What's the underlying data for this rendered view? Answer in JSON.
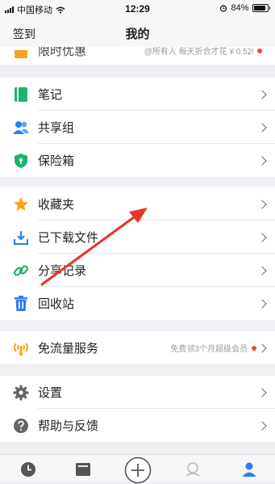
{
  "status_bar": {
    "carrier": "中国移动",
    "time": "12:29",
    "battery": "84%"
  },
  "nav": {
    "left": "签到",
    "title": "我的"
  },
  "promo": {
    "label": "限时优惠",
    "hint": "@所有人 每天折合才花 ¥ 0.52!"
  },
  "group1": [
    {
      "label": "笔记",
      "icon": "notebook-icon"
    },
    {
      "label": "共享组",
      "icon": "people-icon"
    },
    {
      "label": "保险箱",
      "icon": "shield-icon"
    }
  ],
  "group2": [
    {
      "label": "收藏夹",
      "icon": "star-icon"
    },
    {
      "label": "已下载文件",
      "icon": "download-icon"
    },
    {
      "label": "分享记录",
      "icon": "link-icon"
    },
    {
      "label": "回收站",
      "icon": "trash-icon"
    }
  ],
  "flow": {
    "label": "免流量服务",
    "hint": "免费领3个月超级会员",
    "icon": "signal-tower-icon"
  },
  "group4": [
    {
      "label": "设置",
      "icon": "gear-icon"
    },
    {
      "label": "帮助与反馈",
      "icon": "help-icon"
    }
  ],
  "tabs": [
    "clock-icon",
    "folder-icon",
    "plus-icon",
    "discover-icon",
    "profile-icon"
  ],
  "colors": {
    "accent_blue": "#2d7cf6",
    "green": "#1cb468",
    "orange": "#f7a21b",
    "red_dot": "#f04a2a"
  }
}
